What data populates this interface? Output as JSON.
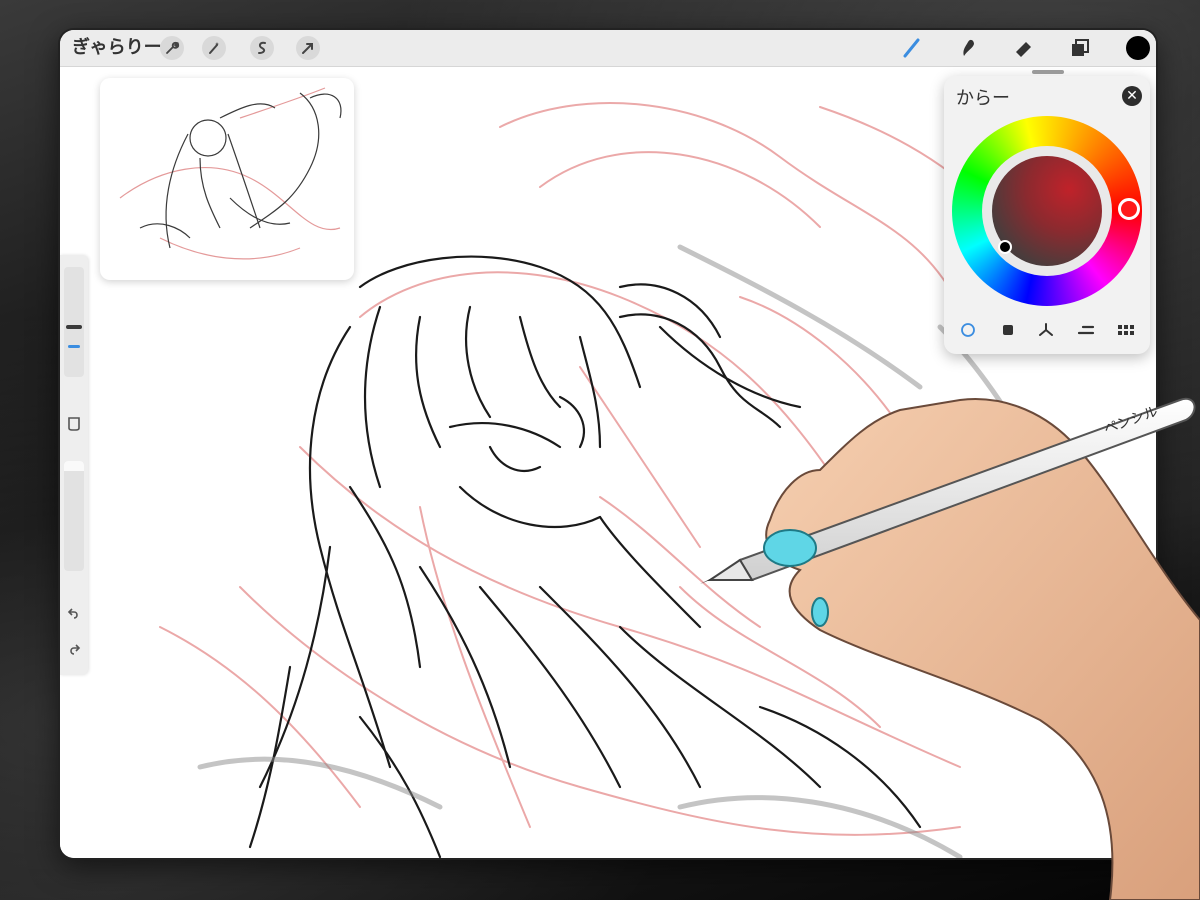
{
  "topbar": {
    "gallery_label": "ぎゃらりー",
    "left_tools": [
      "wrench-icon",
      "magic-wand-icon",
      "selection-icon",
      "transform-arrow-icon"
    ],
    "right_tools": [
      "brush-icon",
      "smudge-icon",
      "eraser-icon",
      "layers-icon"
    ],
    "active_color": "#000000",
    "accent": "#3b8de0"
  },
  "reference": {
    "description_hidden": ""
  },
  "sidebar": {
    "brush_size_level": 0.15,
    "opacity_level": 0.9,
    "modify_icon": "square-icon",
    "undo_icon": "undo-icon",
    "redo_icon": "redo-icon"
  },
  "color_panel": {
    "title": "からー",
    "close_icon": "close-icon",
    "hue_color": "#ff1a1a",
    "selected_color": "#000000",
    "tabs": [
      "disc-icon",
      "classic-icon",
      "harmony-icon",
      "value-icon",
      "palettes-icon"
    ],
    "active_tab": 0
  },
  "pencil": {
    "label": "ペンシル"
  }
}
